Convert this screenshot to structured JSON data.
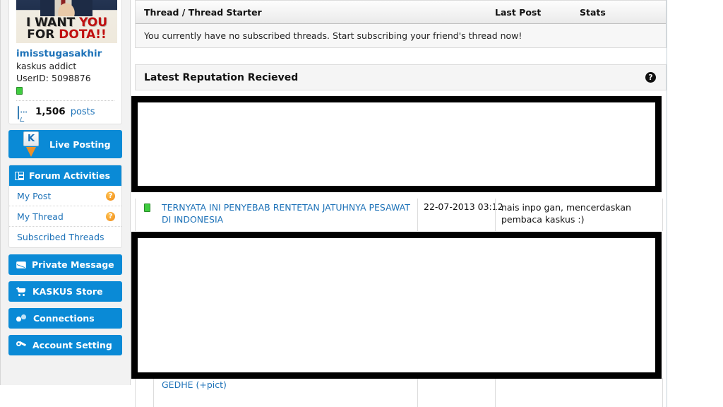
{
  "profile": {
    "avatar_line1_plain": "I WANT ",
    "avatar_line1_red": "YOU",
    "avatar_line2_plain": "FOR ",
    "avatar_line2_red": "DOTA!!",
    "username": "imisstugasakhir",
    "usertitle": "kaskus addict",
    "userid_label": "UserID: 5098876",
    "status_icon": "online-green-icon",
    "posts_count": "1,506",
    "posts_label": "posts",
    "posts_icon": "comment-bubble-icon"
  },
  "sidebar": {
    "live_posting": {
      "label": "Live Posting",
      "icon": "kaskus-pin-icon",
      "pin_glyph": "K"
    },
    "forum_activities": {
      "label": "Forum Activities",
      "icon": "grid-icon",
      "items": [
        {
          "label": "My Post",
          "badge": "?",
          "badge_icon": "help-orange-icon"
        },
        {
          "label": "My Thread",
          "badge": "?",
          "badge_icon": "help-orange-icon"
        },
        {
          "label": "Subscribed Threads",
          "badge": "",
          "badge_icon": ""
        }
      ]
    },
    "buttons": [
      {
        "label": "Private Message",
        "icon": "envelope-icon"
      },
      {
        "label": "KASKUS Store",
        "icon": "cart-icon"
      },
      {
        "label": "Connections",
        "icon": "connections-icon"
      },
      {
        "label": "Account Setting",
        "icon": "wrench-icon"
      }
    ]
  },
  "main": {
    "subscribed_table": {
      "columns": [
        "Thread / Thread Starter",
        "Last Post",
        "Stats"
      ],
      "empty_message": "You currently have no subscribed threads. Start subscribing your friend's thread now!"
    },
    "reputation_section": {
      "title": "Latest Reputation Recieved",
      "help_icon": "help-black-icon",
      "rows": [
        {
          "status_icon": "thread-status-green-icon",
          "thread_title": "TERNYATA INI PENYEBAB RENTETAN JATUHNYA PESAWAT DI INDONESIA",
          "date": "22-07-2013 03:12",
          "comment": "nais inpo gan, mencerdaskan pembaca kaskus :)"
        },
        {
          "status_icon": "",
          "thread_title": "GEDHE (+pict)",
          "date": "",
          "comment": ""
        }
      ]
    }
  },
  "colors": {
    "brand_blue": "#0a8ad6",
    "link_blue": "#1d72b8",
    "accent_orange": "#f08a18",
    "status_green": "#3fcc3f",
    "highlight_box": "#000000"
  }
}
